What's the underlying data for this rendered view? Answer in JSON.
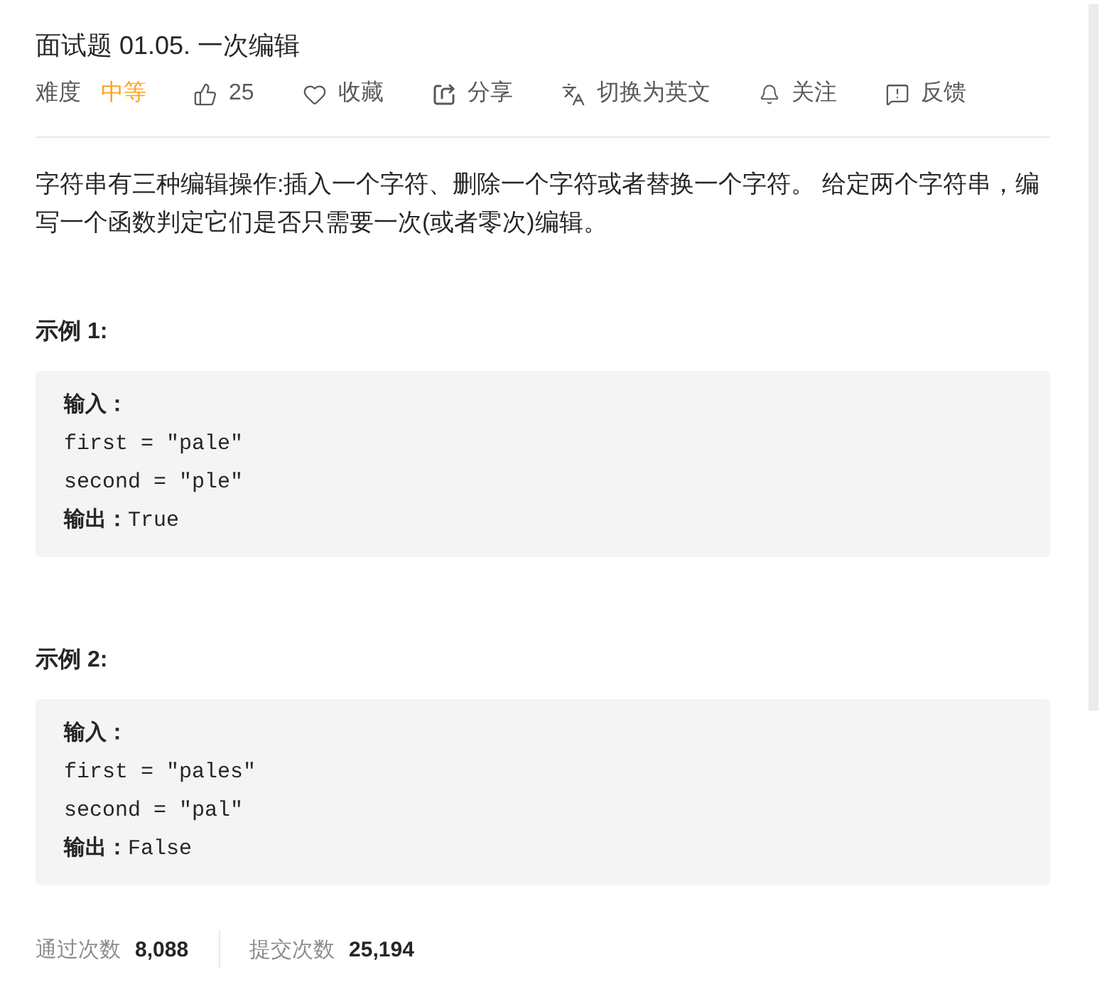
{
  "title": "面试题 01.05. 一次编辑",
  "meta": {
    "difficulty_label": "难度",
    "difficulty": {
      "text": "中等",
      "kind": "medium"
    },
    "actions": [
      {
        "kind": "like",
        "label": "25"
      },
      {
        "kind": "favorite",
        "label": "收藏"
      },
      {
        "kind": "share",
        "label": "分享"
      },
      {
        "kind": "translate",
        "label": "切换为英文"
      },
      {
        "kind": "follow",
        "label": "关注"
      },
      {
        "kind": "feedback",
        "label": "反馈"
      }
    ]
  },
  "description": "字符串有三种编辑操作:插入一个字符、删除一个字符或者替换一个字符。 给定两个字符串，编写一个函数判定它们是否只需要一次(或者零次)编辑。",
  "examples": [
    {
      "heading": "示例 1:",
      "lines": [
        {
          "kind": "label",
          "text": "输入："
        },
        {
          "kind": "code",
          "text": "first = \"pale\""
        },
        {
          "kind": "code",
          "text": "second = \"ple\""
        },
        {
          "kind": "code",
          "text": "**输出：**True"
        }
      ]
    },
    {
      "heading": "示例 2:",
      "lines": [
        {
          "kind": "label",
          "text": "输入："
        },
        {
          "kind": "code",
          "text": "first = \"pales\""
        },
        {
          "kind": "code",
          "text": "second = \"pal\""
        },
        {
          "kind": "code",
          "text": "**输出：**False"
        }
      ]
    }
  ],
  "stats": [
    {
      "label": "通过次数",
      "value": "8,088"
    },
    {
      "label": "提交次数",
      "value": "25,194"
    }
  ]
}
